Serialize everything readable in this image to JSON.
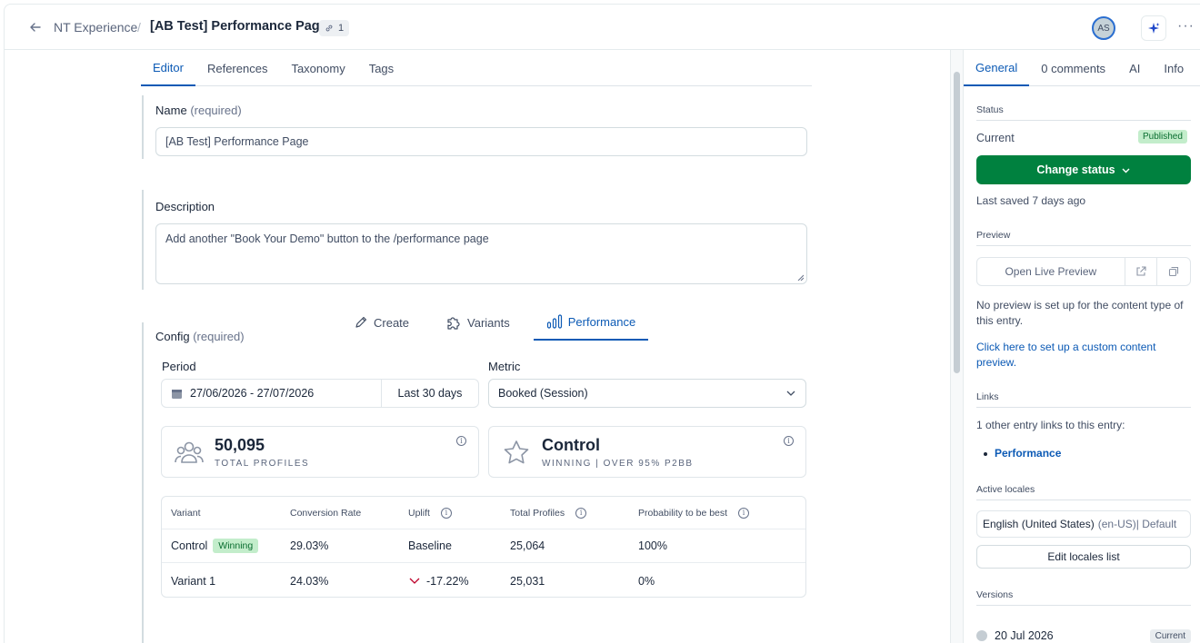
{
  "header": {
    "parent": "NT Experience",
    "separator": "/",
    "title": "[AB Test] Performance Page",
    "references_count": "1",
    "avatar_initials": "AS"
  },
  "editor": {
    "tabs": [
      "Editor",
      "References",
      "Taxonomy",
      "Tags"
    ],
    "name": {
      "label": "Name",
      "required": "(required)",
      "value": "[AB Test] Performance Page"
    },
    "description": {
      "label": "Description",
      "value": "Add another \"Book Your Demo\" button to the /performance page"
    },
    "config": {
      "label": "Config",
      "required": "(required)",
      "subtabs": [
        "Create",
        "Variants",
        "Performance"
      ],
      "period_label": "Period",
      "period_dates": "27/06/2026 - 27/07/2026",
      "period_range": "Last 30 days",
      "metric_label": "Metric",
      "metric_value": "Booked (Session)",
      "kpis": [
        {
          "value": "50,095",
          "caption": "TOTAL PROFILES",
          "icon": "people-icon"
        },
        {
          "value": "Control",
          "caption": "WINNING | OVER 95% P2BB",
          "icon": "star-icon"
        }
      ],
      "table": {
        "headers": [
          "Variant",
          "Conversion Rate",
          "Uplift",
          "Total Profiles",
          "Probability to be best"
        ],
        "rows": [
          {
            "variant": "Control",
            "badge": "Winning",
            "conversion": "29.03%",
            "uplift": "Baseline",
            "profiles": "25,064",
            "probability": "100%"
          },
          {
            "variant": "Variant 1",
            "badge": "",
            "conversion": "24.03%",
            "uplift": "-17.22%",
            "profiles": "25,031",
            "probability": "0%"
          }
        ]
      }
    }
  },
  "sidebar": {
    "tabs": [
      "General",
      "0 comments",
      "AI",
      "Info"
    ],
    "status_title": "Status",
    "current_label": "Current",
    "published": "Published",
    "change_status": "Change status",
    "last_saved": "Last saved 7 days ago",
    "preview_title": "Preview",
    "open_live_preview": "Open Live Preview",
    "no_preview": "No preview is set up for the content type of this entry.",
    "setup_link": "Click here to set up a custom content preview.",
    "links_title": "Links",
    "links_text": "1 other entry links to this entry:",
    "link_item": "Performance",
    "locales_title": "Active locales",
    "locale_name": "English (United States)",
    "locale_code": "(en-US)",
    "locale_default": "| Default",
    "edit_locales": "Edit locales list",
    "versions_title": "Versions",
    "version_date": "20 Jul 2026",
    "version_badge": "Current"
  },
  "colors": {
    "accent": "#0c5ab5",
    "primary_button": "#00813f",
    "success_badge": "#c3edcb",
    "negative": "#bd002a"
  }
}
